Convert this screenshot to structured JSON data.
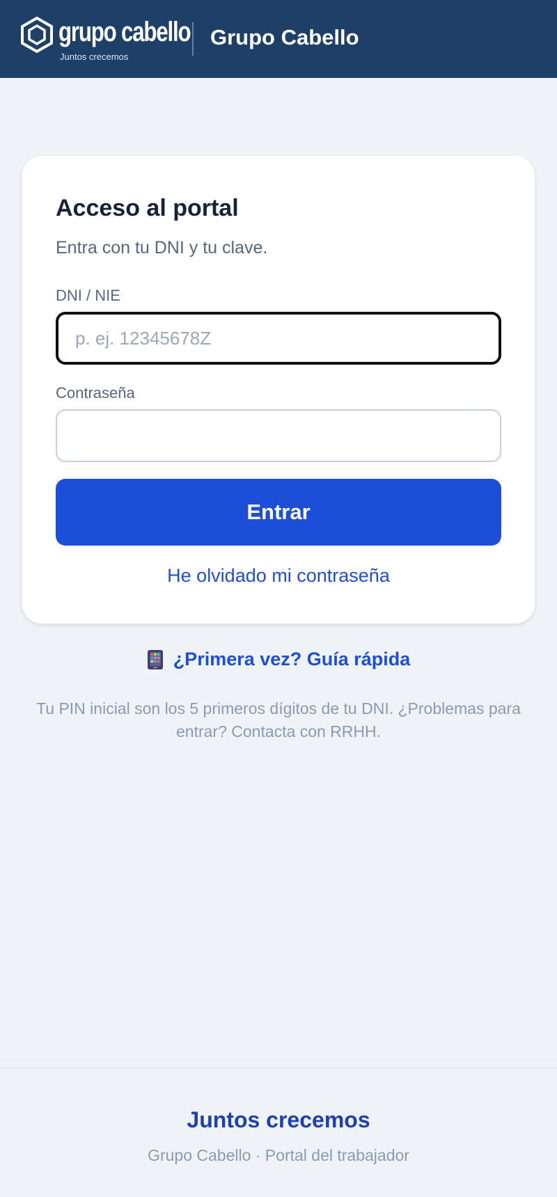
{
  "header": {
    "logo_text": "grupo cabello",
    "logo_tagline": "Juntos crecemos",
    "title": "Grupo Cabello"
  },
  "login_card": {
    "title": "Acceso al portal",
    "subtitle": "Entra con tu DNI y tu clave.",
    "dni_label": "DNI / NIE",
    "dni_value": "",
    "dni_placeholder": "p. ej. 12345678Z",
    "password_label": "Contraseña",
    "password_value": "",
    "password_placeholder": "",
    "submit_label": "Entrar",
    "forgot_label": "He olvidado mi contraseña"
  },
  "guide": {
    "icon": "mobile-phone-icon",
    "label": "¿Primera vez? Guía rápida"
  },
  "help_text": "Tu PIN inicial son los 5 primeros dígitos de tu DNI. ¿Problemas para entrar? Contacta con RRHH.",
  "footer": {
    "slogan": "Juntos crecemos",
    "subtitle": "Grupo Cabello · Portal del trabajador"
  },
  "colors": {
    "header_bg": "#1e4068",
    "page_bg": "#eff3f8",
    "primary": "#1d4ed8",
    "footer_slogan": "#1e40af",
    "muted_text": "#8a9bb0"
  }
}
